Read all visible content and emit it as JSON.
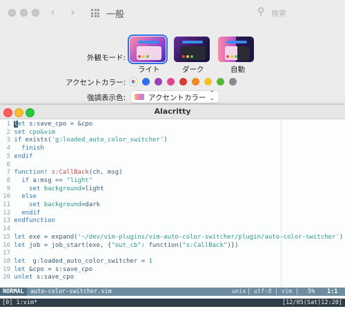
{
  "settings": {
    "window_title": "一般",
    "search_placeholder": "検索",
    "appearance_label": "外観モード:",
    "appearance_options": [
      "ライト",
      "ダーク",
      "自動"
    ],
    "accent_label": "アクセントカラー:",
    "accent_colors": [
      "#d84cd4",
      "#2f6fe8",
      "#9b3fb5",
      "#e0478f",
      "#d93a36",
      "#f08a24",
      "#f2c12c",
      "#5ab838",
      "#8a8a8a"
    ],
    "highlight_label": "強調表示色:",
    "highlight_value": "アクセントカラー"
  },
  "terminal": {
    "title": "Alacritty",
    "lines": [
      {
        "n": "1",
        "segs": [
          [
            "kw",
            "l"
          ],
          [
            "kw",
            "et"
          ],
          [
            "code",
            " s:save_cpo = &cpo"
          ]
        ]
      },
      {
        "n": "2",
        "segs": [
          [
            "kw",
            "set"
          ],
          [
            "code",
            " "
          ],
          [
            "str",
            "cpo&vim"
          ]
        ]
      },
      {
        "n": "3",
        "segs": [
          [
            "kw",
            "if"
          ],
          [
            "code",
            " exists("
          ],
          [
            "str",
            "'g:loaded_auto_color_switcher'"
          ],
          [
            "code",
            ")"
          ]
        ]
      },
      {
        "n": "4",
        "segs": [
          [
            "code",
            "  "
          ],
          [
            "kw",
            "finish"
          ]
        ]
      },
      {
        "n": "5",
        "segs": [
          [
            "kw",
            "endif"
          ]
        ]
      },
      {
        "n": "6",
        "segs": []
      },
      {
        "n": "7",
        "segs": [
          [
            "kw",
            "function!"
          ],
          [
            "code",
            " "
          ],
          [
            "fn",
            "s:CallBack"
          ],
          [
            "code",
            "(ch, msg)"
          ]
        ]
      },
      {
        "n": "8",
        "segs": [
          [
            "code",
            "  "
          ],
          [
            "kw",
            "if"
          ],
          [
            "code",
            " a:msg == "
          ],
          [
            "str",
            "\"light\""
          ]
        ]
      },
      {
        "n": "9",
        "segs": [
          [
            "code",
            "    "
          ],
          [
            "kw",
            "set"
          ],
          [
            "code",
            " "
          ],
          [
            "str",
            "background"
          ],
          [
            "code",
            "=light"
          ]
        ]
      },
      {
        "n": "10",
        "segs": [
          [
            "code",
            "  "
          ],
          [
            "kw",
            "else"
          ]
        ]
      },
      {
        "n": "11",
        "segs": [
          [
            "code",
            "    "
          ],
          [
            "kw",
            "set"
          ],
          [
            "code",
            " "
          ],
          [
            "str",
            "background"
          ],
          [
            "code",
            "=dark"
          ]
        ]
      },
      {
        "n": "12",
        "segs": [
          [
            "code",
            "  "
          ],
          [
            "kw",
            "endif"
          ]
        ]
      },
      {
        "n": "13",
        "segs": [
          [
            "kw",
            "endfunction"
          ]
        ]
      },
      {
        "n": "14",
        "segs": []
      },
      {
        "n": "15",
        "segs": [
          [
            "kw",
            "let"
          ],
          [
            "code",
            " exe = expand("
          ],
          [
            "str",
            "'~/dev/vim-plugins/vim-auto-color-switcher/plugin/auto-color-switcher'"
          ],
          [
            "code",
            ")"
          ]
        ]
      },
      {
        "n": "16",
        "segs": [
          [
            "kw",
            "let"
          ],
          [
            "code",
            " job = job_start(exe, {"
          ],
          [
            "str",
            "\"out_cb\""
          ],
          [
            "code",
            ": function("
          ],
          [
            "str",
            "\"s:CallBack\""
          ],
          [
            "code",
            ")})"
          ]
        ]
      },
      {
        "n": "17",
        "segs": []
      },
      {
        "n": "18",
        "segs": [
          [
            "kw",
            "let"
          ],
          [
            "code",
            "  g:loaded_auto_color_switcher = "
          ],
          [
            "num",
            "1"
          ]
        ]
      },
      {
        "n": "19",
        "segs": [
          [
            "kw",
            "let"
          ],
          [
            "code",
            " &cpo = s:save_cpo"
          ]
        ]
      },
      {
        "n": "20",
        "segs": [
          [
            "kw",
            "unlet"
          ],
          [
            "code",
            " s:save_cpo"
          ]
        ]
      }
    ],
    "status": {
      "mode": "NORMAL",
      "file": "auto-color-switcher.vim",
      "format": "unix",
      "encoding": "utf-8",
      "filetype": "vim",
      "percent": "5%",
      "position": "1:1"
    },
    "tmux": {
      "left": "[0] 1:vim*",
      "right": "[12/05(Sat)12:20]"
    }
  }
}
